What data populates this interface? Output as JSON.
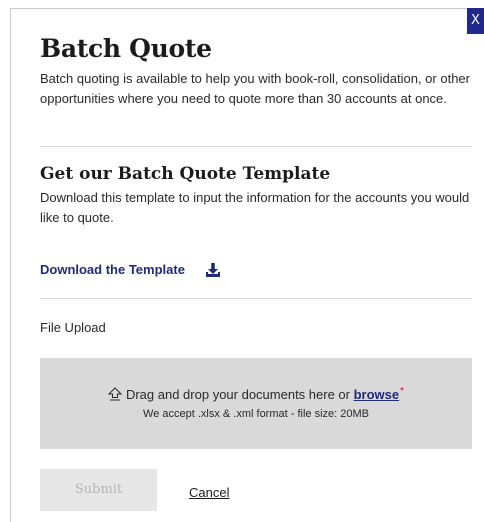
{
  "modal": {
    "close_label": "X",
    "title": "Batch Quote",
    "intro": "Batch quoting is available to help you with book-roll, consolidation, or other opportunities where you need to quote more than 30 accounts at once."
  },
  "template_section": {
    "title": "Get our Batch Quote Template",
    "description": "Download this template to input the information for the accounts you would like to quote.",
    "download_label": "Download the Template",
    "download_icon": "download-icon"
  },
  "upload": {
    "label": "File Upload",
    "drop_text": "Drag and drop your documents here or",
    "browse_label": "browse",
    "required_mark": "*",
    "formats_text": "We accept .xlsx & .xml format - file size: 20MB",
    "upload_icon": "upload-arrow-icon"
  },
  "actions": {
    "submit_label": "Submit",
    "cancel_label": "Cancel"
  },
  "colors": {
    "accent": "#1f2a8c",
    "link": "#1f2a7a",
    "dropzone_bg": "#d9d9d9",
    "required": "#d0021b"
  }
}
